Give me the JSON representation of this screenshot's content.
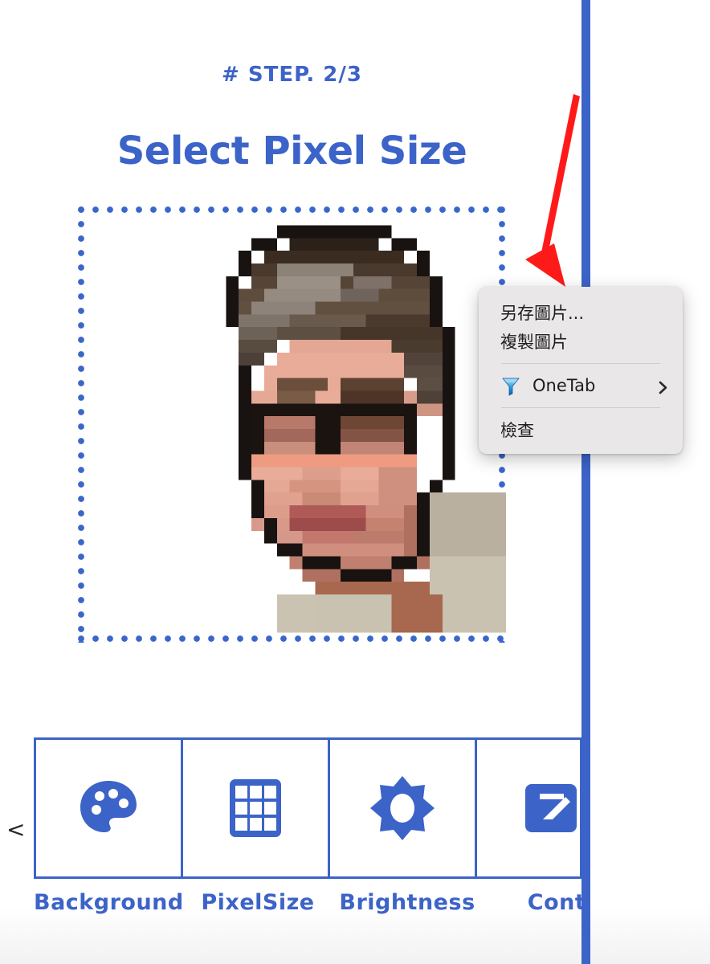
{
  "app": {
    "accent_color": "#3c63c8",
    "arrow_annotation_color": "#ff1a1a"
  },
  "header": {
    "step_label": "# STEP. 2/3",
    "title": "Select Pixel Size"
  },
  "canvas": {
    "name": "pixelated-portrait-preview",
    "border_style": "blue-dotted",
    "border_color": "#3a66cc",
    "description": "Pixel-art portrait of a person wearing glasses"
  },
  "context_menu": {
    "items": [
      {
        "id": "save-image-as",
        "label": "另存圖片...",
        "icon": null,
        "submenu": false
      },
      {
        "id": "copy-image",
        "label": "複製圖片",
        "icon": null,
        "submenu": false
      },
      {
        "id": "separator-1",
        "type": "separator"
      },
      {
        "id": "onetab",
        "label": "OneTab",
        "icon": "onetab-funnel-icon",
        "submenu": true,
        "submenu_icon": "chevron-right-icon"
      },
      {
        "id": "separator-2",
        "type": "separator"
      },
      {
        "id": "inspect",
        "label": "檢查",
        "icon": null,
        "submenu": false
      }
    ],
    "background_color": "#eae7e9"
  },
  "toolbar": {
    "prev_label": "<",
    "next_label": ">",
    "items": [
      {
        "id": "background",
        "label": "Background",
        "icon": "palette-icon"
      },
      {
        "id": "pixelsize",
        "label": "PixelSize",
        "icon": "grid-3x3-icon"
      },
      {
        "id": "brightness",
        "label": "Brightness",
        "icon": "sun-burst-icon"
      },
      {
        "id": "contrast",
        "label": "Cont",
        "icon": "contrast-icon"
      }
    ]
  }
}
